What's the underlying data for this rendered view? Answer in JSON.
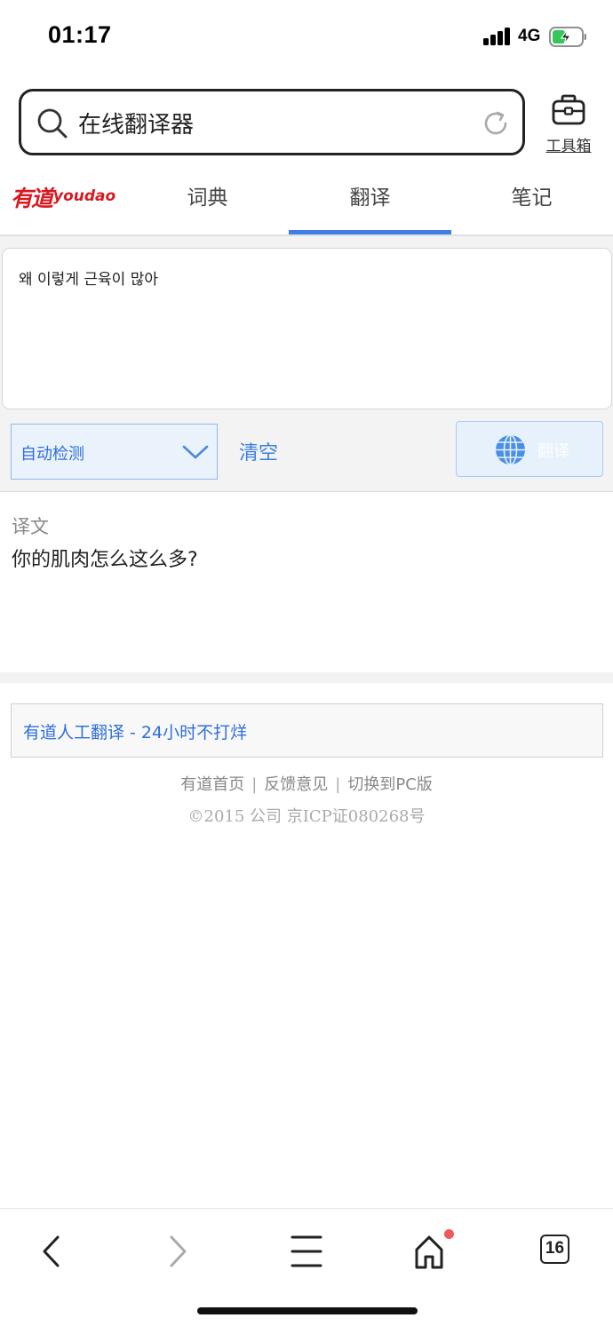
{
  "status_bar": {
    "time": "01:17",
    "network": "4G",
    "battery_color": "#34c759"
  },
  "browser": {
    "search_query": "在线翻译器",
    "toolbox_label": "工具箱"
  },
  "youdao": {
    "logo_cn": "有道",
    "logo_en": "youdao",
    "brand_color": "#d71921",
    "accent_color": "#3d7fe6",
    "tabs": [
      {
        "label": "词典",
        "active": false
      },
      {
        "label": "翻译",
        "active": true
      },
      {
        "label": "笔记",
        "active": false
      }
    ]
  },
  "translator": {
    "input_text": "왜 이렇게 근육이  많아",
    "language_select": "自动检测",
    "clear_label": "清空",
    "translate_label": "翻译",
    "result_heading": "译文",
    "result_text": "你的肌肉怎么这么多?"
  },
  "promo": {
    "text": "有道人工翻译 - 24小时不打烊"
  },
  "footer": {
    "links": [
      "有道首页",
      "反馈意见",
      "切换到PC版"
    ],
    "separator": "|",
    "copyright": "©2015 公司 京ICP证080268号"
  },
  "bottom_bar": {
    "tab_count": "16",
    "icons": [
      "back-icon",
      "forward-icon",
      "menu-icon",
      "home-icon",
      "tabs-icon"
    ]
  }
}
